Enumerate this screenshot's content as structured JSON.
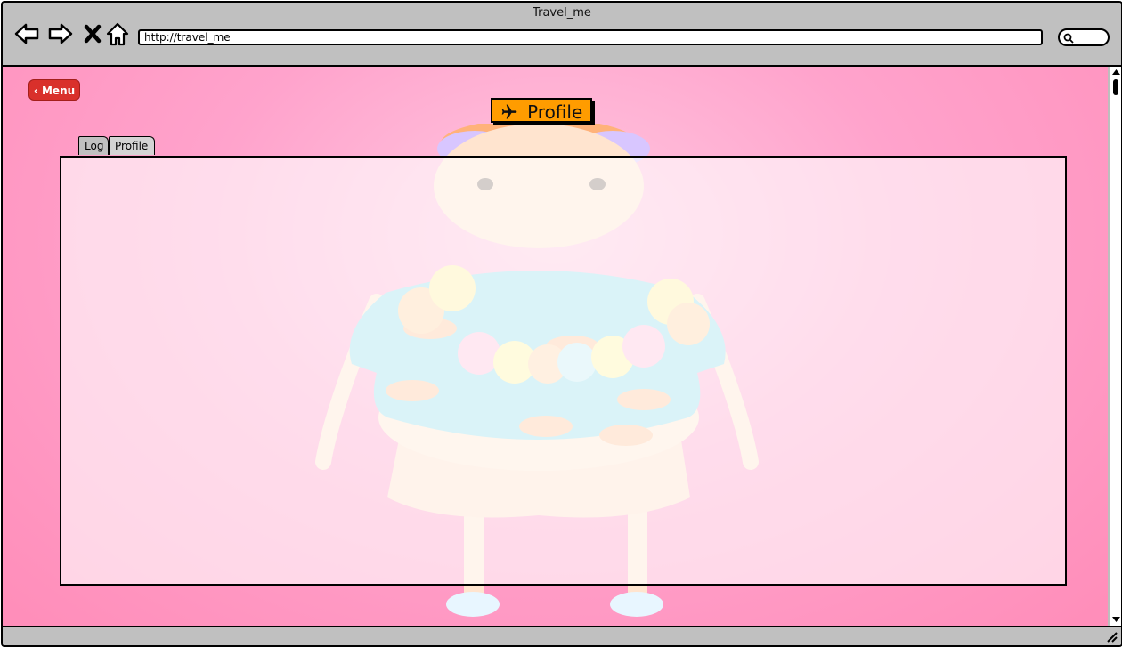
{
  "browser": {
    "title": "Travel_me",
    "url": "http://travel_me"
  },
  "page": {
    "menu_button": "Menu",
    "badge": {
      "label": "Profile",
      "icon": "airplane-icon",
      "color": "#ff9c00"
    },
    "tabs": [
      {
        "label": "Log",
        "active": false
      },
      {
        "label": "Profile",
        "active": true
      }
    ],
    "background_color": "#ff8db9",
    "menu_color": "#d9302b"
  }
}
